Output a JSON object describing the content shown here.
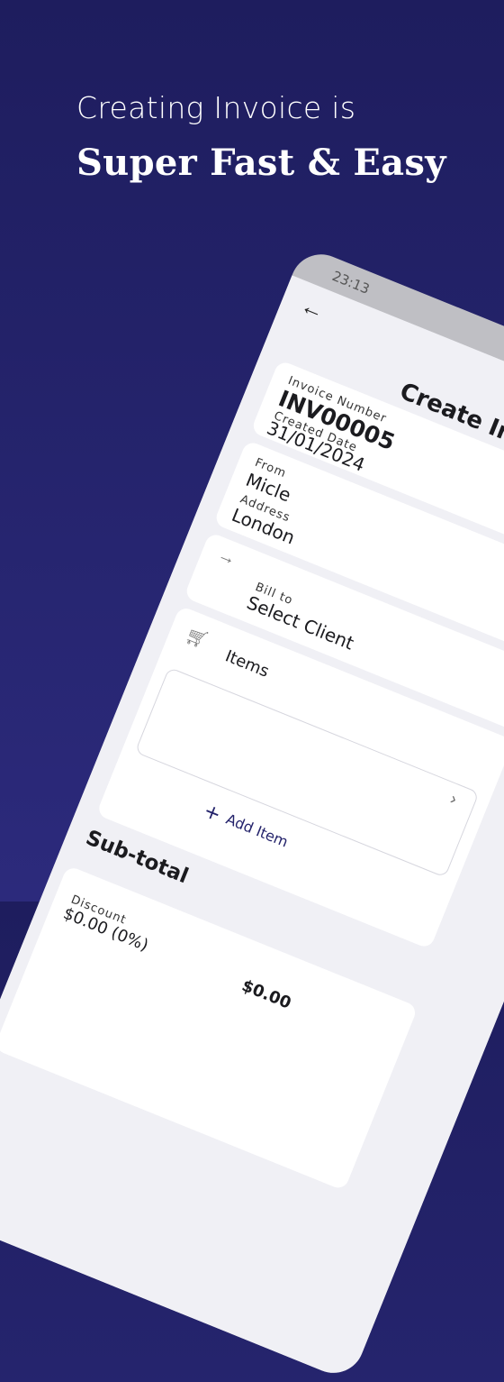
{
  "promo": {
    "line1": "Creating Invoice is",
    "line2": "Super Fast & Easy"
  },
  "status_bar": {
    "time": "23:13"
  },
  "header": {
    "title": "Create Invoice"
  },
  "invoice": {
    "number_label": "Invoice Number",
    "number": "INV00005",
    "date_label": "Created Date",
    "date": "31/01/2024"
  },
  "from": {
    "label": "From",
    "name": "Micle",
    "address_label": "Address",
    "address": "London"
  },
  "bill_to": {
    "label": "Bill to",
    "value": "Select Client"
  },
  "items": {
    "label": "Items",
    "add_label": "Add Item"
  },
  "subtotal": {
    "title": "Sub-total",
    "discount_label": "Discount",
    "discount_value": "$0.00 (0%)",
    "amount": "$0.00"
  },
  "icons": {
    "back": "arrow-left-icon",
    "bill_to": "arrow-right-icon",
    "items": "cart-icon",
    "chevron": "chevron-right-icon"
  }
}
